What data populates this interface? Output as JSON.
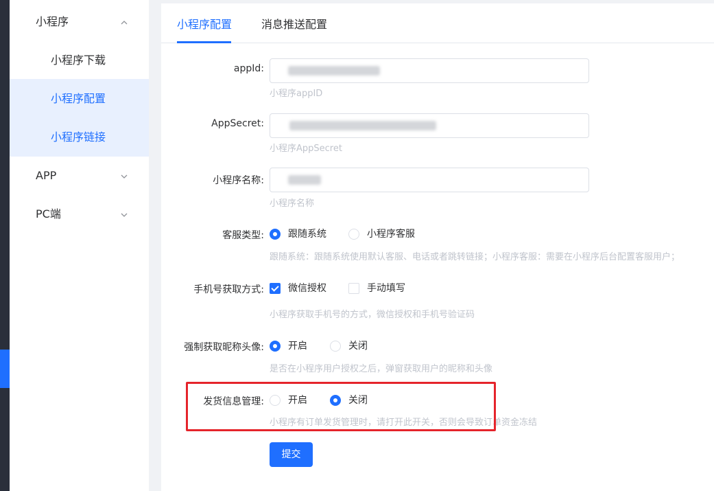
{
  "sidebar": {
    "groups": [
      {
        "label": "小程序",
        "expanded": true,
        "items": [
          {
            "label": "小程序下载",
            "active": false
          },
          {
            "label": "小程序配置",
            "active": true
          },
          {
            "label": "小程序链接",
            "active": true
          }
        ]
      },
      {
        "label": "APP",
        "expanded": false
      },
      {
        "label": "PC端",
        "expanded": false
      }
    ]
  },
  "tabs": [
    {
      "label": "小程序配置",
      "active": true
    },
    {
      "label": "消息推送配置",
      "active": false
    }
  ],
  "form": {
    "appid": {
      "label": "appId:",
      "help": "小程序appID"
    },
    "appsecret": {
      "label": "AppSecret:",
      "help": "小程序AppSecret"
    },
    "name": {
      "label": "小程序名称:",
      "help": "小程序名称"
    },
    "service_type": {
      "label": "客服类型:",
      "options": [
        "跟随系统",
        "小程序客服"
      ],
      "selected": "跟随系统",
      "help": "跟随系统：跟随系统使用默认客服、电话或者跳转链接；小程序客服：需要在小程序后台配置客服用户；"
    },
    "phone_method": {
      "label": "手机号获取方式:",
      "options": [
        "微信授权",
        "手动填写"
      ],
      "checked": [
        "微信授权"
      ],
      "help": "小程序获取手机号的方式，微信授权和手机号验证码"
    },
    "force_avatar": {
      "label": "强制获取昵称头像:",
      "options": [
        "开启",
        "关闭"
      ],
      "selected": "开启",
      "help": "是否在小程序用户授权之后，弹窗获取用户的昵称和头像"
    },
    "shipping": {
      "label": "发货信息管理:",
      "options": [
        "开启",
        "关闭"
      ],
      "selected": "关闭",
      "help": "小程序有订单发货管理时，请打开此开关，否则会导致订单资金冻结"
    },
    "submit_label": "提交"
  },
  "icons": {
    "expanded": "chevron-up-icon",
    "collapsed": "chevron-down-icon"
  },
  "colors": {
    "primary": "#1f6fff",
    "highlight": "#e5242b",
    "rail": "#2a2f3b"
  }
}
